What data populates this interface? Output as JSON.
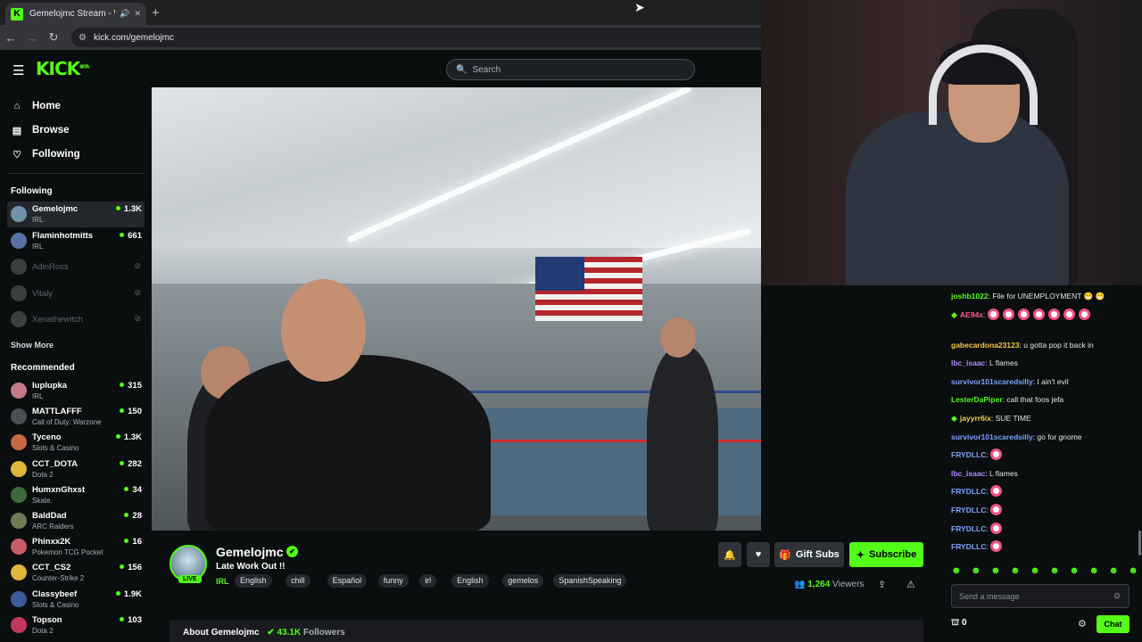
{
  "browser": {
    "tab_title": "Gemelojmc Stream - Watc",
    "favicon": "K",
    "new_tab": "+",
    "url": "kick.com/gemelojmc",
    "close": "✕",
    "mute": "🔊"
  },
  "header": {
    "logo": "KICK",
    "logo_badge": "BETA",
    "search_placeholder": "Search"
  },
  "sidebar": {
    "nav": [
      {
        "label": "Home",
        "icon": "home-icon"
      },
      {
        "label": "Browse",
        "icon": "browse-icon"
      },
      {
        "label": "Following",
        "icon": "heart-icon"
      }
    ],
    "following_title": "Following",
    "following": [
      {
        "name": "Gemelojmc",
        "category": "IRL",
        "viewers": "1.3K",
        "live": true,
        "color": "#6f93a9"
      },
      {
        "name": "Flaminhotmitts",
        "category": "IRL",
        "viewers": "661",
        "live": true,
        "color": "#5873a3"
      },
      {
        "name": "AdinRoss",
        "category": "",
        "viewers": "",
        "live": false,
        "color": "#9a9a9a"
      },
      {
        "name": "Vitaly",
        "category": "",
        "viewers": "",
        "live": false,
        "color": "#9a9a9a"
      },
      {
        "name": "Xenathewitch",
        "category": "",
        "viewers": "",
        "live": false,
        "color": "#9a9a9a"
      }
    ],
    "show_more": "Show More",
    "recommended_title": "Recommended",
    "recommended": [
      {
        "name": "luplupka",
        "category": "IRL",
        "viewers": "315",
        "color": "#c47a86"
      },
      {
        "name": "MATTLAFFF",
        "category": "Call of Duty: Warzone",
        "viewers": "150",
        "color": "#4b4f55"
      },
      {
        "name": "Tyceno",
        "category": "Slots & Casino",
        "viewers": "1.3K",
        "color": "#c86a3f"
      },
      {
        "name": "CCT_DOTA",
        "category": "Dota 2",
        "viewers": "282",
        "color": "#e0b53b"
      },
      {
        "name": "HumxnGhxst",
        "category": "Skate.",
        "viewers": "34",
        "color": "#3a6b3c"
      },
      {
        "name": "BaldDad",
        "category": "ARC Raiders",
        "viewers": "28",
        "color": "#6d7b52"
      },
      {
        "name": "Phinxx2K",
        "category": "Pokemon TCG Pocket",
        "viewers": "16",
        "color": "#c95b67"
      },
      {
        "name": "CCT_CS2",
        "category": "Counter-Strike 2",
        "viewers": "156",
        "color": "#e0b53b"
      },
      {
        "name": "Classybeef",
        "category": "Slots & Casino",
        "viewers": "1.9K",
        "color": "#3c5b9a"
      },
      {
        "name": "Topson",
        "category": "Dota 2",
        "viewers": "103",
        "color": "#c2375b"
      }
    ]
  },
  "stream": {
    "name": "Gemelojmc",
    "live": "LIVE",
    "title": "Late Work Out !!",
    "category": "IRL",
    "tags": [
      "English",
      "chill",
      "Español",
      "funny",
      "irl",
      "English",
      "gemelos",
      "SpanishSpeaking"
    ],
    "gift_subs": "Gift Subs",
    "subscribe": "Subscribe",
    "viewers_count": "1,264",
    "viewers_label": "Viewers",
    "about": "About Gemelojmc",
    "followers_count": "43.1K",
    "followers_label": "Followers"
  },
  "chat": {
    "messages": [
      {
        "user": "joshb1022",
        "color": "#53fc18",
        "text": "File for UNEMPLOYMENT 😁 😁",
        "badge": false,
        "emotes": 0
      },
      {
        "user": "AE94x",
        "color": "#ff5a8c",
        "text": "",
        "badge": true,
        "emotes": 7
      },
      {
        "user": "gabecardona23123",
        "color": "#f2c94c",
        "text": "u gotta pop it back in",
        "badge": false,
        "emotes": 0
      },
      {
        "user": "lbc_isaac",
        "color": "#b18cff",
        "text": "L flames",
        "badge": false,
        "emotes": 0
      },
      {
        "user": "survivor101scaredsilly",
        "color": "#7aa2ff",
        "text": "I ain't evil",
        "badge": false,
        "emotes": 0
      },
      {
        "user": "LesterDaPiper",
        "color": "#53fc18",
        "text": "call that foos jefa",
        "badge": false,
        "emotes": 0
      },
      {
        "user": "jayyrr6ix",
        "color": "#f2c94c",
        "text": "SUE TIME",
        "badge": true,
        "emotes": 0
      },
      {
        "user": "survivor101scaredsilly",
        "color": "#7aa2ff",
        "text": "go for gnome",
        "badge": false,
        "emotes": 0
      },
      {
        "user": "FRYDLLC",
        "color": "#7aa2ff",
        "text": "",
        "badge": false,
        "emotes": 1
      },
      {
        "user": "lbc_isaac",
        "color": "#b18cff",
        "text": "L flames",
        "badge": false,
        "emotes": 0
      },
      {
        "user": "FRYDLLC",
        "color": "#7aa2ff",
        "text": "",
        "badge": false,
        "emotes": 1
      },
      {
        "user": "FRYDLLC",
        "color": "#7aa2ff",
        "text": "",
        "badge": false,
        "emotes": 1
      },
      {
        "user": "FRYDLLC",
        "color": "#7aa2ff",
        "text": "",
        "badge": false,
        "emotes": 1
      },
      {
        "user": "FRYDLLC",
        "color": "#7aa2ff",
        "text": "",
        "badge": false,
        "emotes": 1
      }
    ],
    "input_placeholder": "Send a message",
    "points": "0",
    "chat_button": "Chat"
  }
}
